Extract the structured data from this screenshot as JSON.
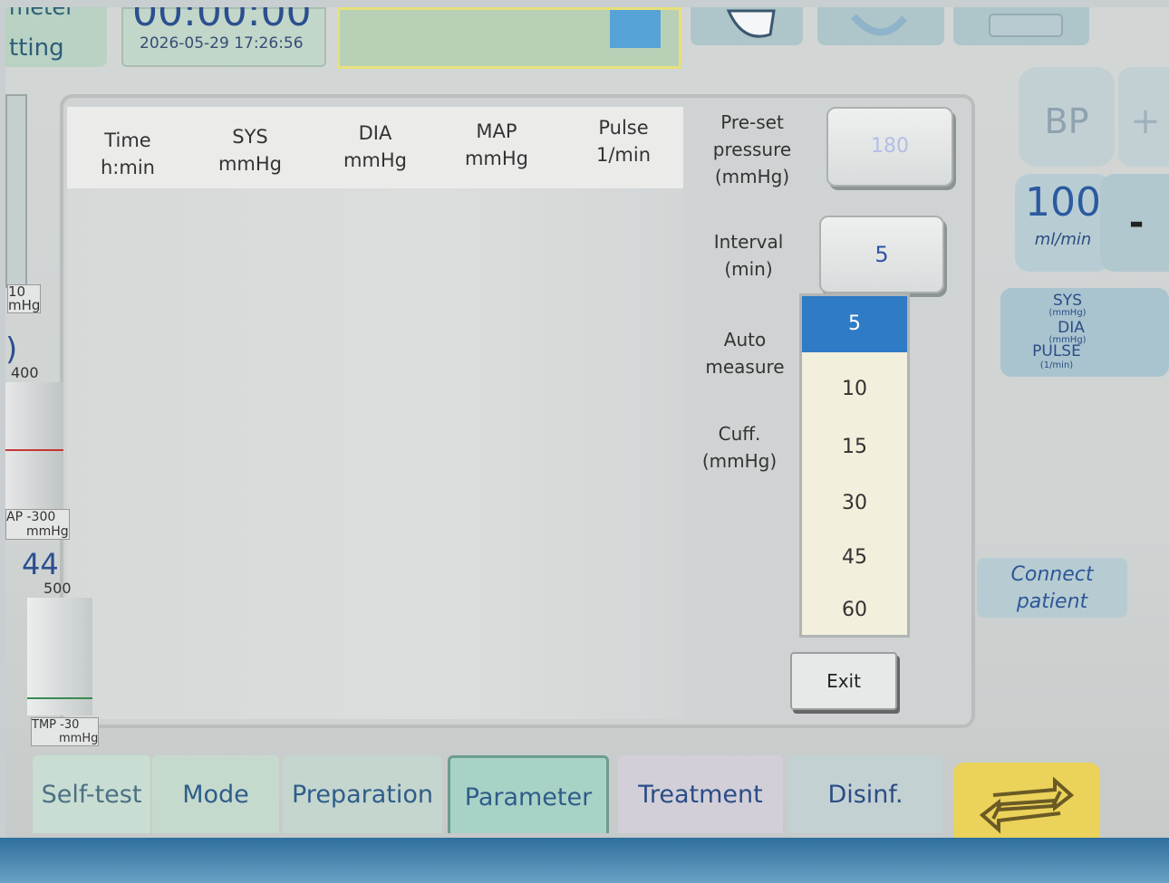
{
  "header": {
    "mode_label_line1": "meter",
    "mode_label_line2": "tting",
    "timer_value": "00:00:00",
    "datetime": "2026-05-29 17:26:56"
  },
  "table": {
    "columns": [
      {
        "name": "Time",
        "unit": "h:min"
      },
      {
        "name": "SYS",
        "unit": "mmHg"
      },
      {
        "name": "DIA",
        "unit": "mmHg"
      },
      {
        "name": "MAP",
        "unit": "mmHg"
      },
      {
        "name": "Pulse",
        "unit": "1/min"
      }
    ],
    "rows": []
  },
  "params": {
    "preset_pressure_label": [
      "Pre-set",
      "pressure",
      "(mmHg)"
    ],
    "preset_pressure_value": "180",
    "interval_label": [
      "Interval",
      "(min)"
    ],
    "interval_value": "5",
    "auto_measure_label": [
      "Auto",
      "measure"
    ],
    "cuff_label": [
      "Cuff.",
      "(mmHg)"
    ]
  },
  "interval_dropdown": {
    "options": [
      "5",
      "10",
      "15",
      "30",
      "45",
      "60"
    ],
    "selected": "5"
  },
  "exit_label": "Exit",
  "left_gauges": {
    "g1_value": "10",
    "g1_unit": "mHg",
    "g2_partial": ")",
    "g2_max": "400",
    "g2_min": "-300",
    "g2_unit": "mmHg",
    "g2_label": "AP",
    "g3_value": "44",
    "g3_max": "500",
    "g3_min": "-30",
    "g3_unit": "mmHg",
    "g3_label": "TMP"
  },
  "right_panel": {
    "bp_label": "BP",
    "plus_label": "+",
    "minus_label": "-",
    "rate_value": "100",
    "rate_unit": "ml/min",
    "sys_label": "SYS",
    "sys_unit": "(mmHg)",
    "dia_label": "DIA",
    "dia_unit": "(mmHg)",
    "pulse_label": "PULSE",
    "pulse_unit": "(1/min)",
    "connect_line1": "Connect",
    "connect_line2": "patient"
  },
  "tabs": [
    {
      "label": "Self-test",
      "active": false
    },
    {
      "label": "Mode",
      "active": false
    },
    {
      "label": "Preparation",
      "active": false
    },
    {
      "label": "Parameter",
      "active": true
    },
    {
      "label": "Treatment",
      "active": false
    },
    {
      "label": "Disinf.",
      "active": false
    }
  ],
  "colors": {
    "accent_blue": "#2f7bc6",
    "active_tab": "#a9d2c6",
    "cycle_button": "#ebd25a"
  }
}
